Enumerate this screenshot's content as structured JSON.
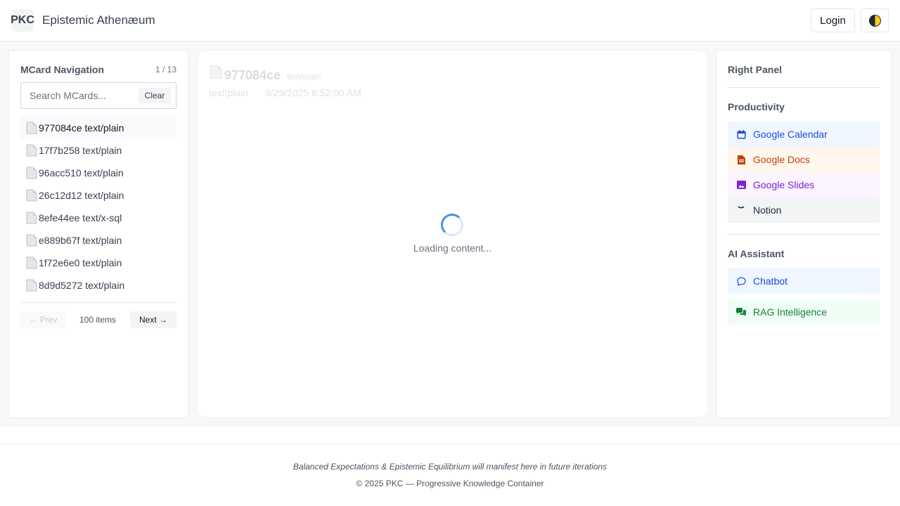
{
  "header": {
    "logo": "PKC",
    "title": "Epistemic Athenæum",
    "login_label": "Login",
    "theme_icon": "half-moon-icon"
  },
  "nav": {
    "title": "MCard Navigation",
    "count": "1 / 13",
    "search_placeholder": "Search MCards...",
    "clear_label": "Clear",
    "items": [
      {
        "hash": "977084ce",
        "type": "text/plain"
      },
      {
        "hash": "17f7b258",
        "type": "text/plain"
      },
      {
        "hash": "96acc510",
        "type": "text/plain"
      },
      {
        "hash": "26c12d12",
        "type": "text/plain"
      },
      {
        "hash": "8efe44ee",
        "type": "text/x-sql"
      },
      {
        "hash": "e889b67f",
        "type": "text/plain"
      },
      {
        "hash": "1f72e6e0",
        "type": "text/plain"
      },
      {
        "hash": "8d9d5272",
        "type": "text/plain"
      }
    ],
    "prev_label": "← Prev",
    "items_count": "100 items",
    "next_label": "Next →"
  },
  "content": {
    "hash": "977084ce",
    "type_badge": "text/plain",
    "type": "text/plain",
    "timestamp": "9/29/2025 6:52:00 AM",
    "loading_text": "Loading content..."
  },
  "right": {
    "title": "Right Panel",
    "productivity_title": "Productivity",
    "productivity": [
      {
        "label": "Google Calendar",
        "icon": "calendar-icon",
        "color": "#1d4ed8",
        "bg": "#eff6ff"
      },
      {
        "label": "Google Docs",
        "icon": "document-icon",
        "color": "#c2410c",
        "bg": "#fff7ed"
      },
      {
        "label": "Google Slides",
        "icon": "image-icon",
        "color": "#7e22ce",
        "bg": "#faf5ff"
      },
      {
        "label": "Notion",
        "icon": "notion-icon",
        "color": "#1f2937",
        "bg": "#f3f4f6"
      }
    ],
    "ai_title": "AI Assistant",
    "ai": [
      {
        "label": "Chatbot",
        "icon": "chat-bubble-icon",
        "color": "#1d4ed8",
        "bg": "#eff6ff"
      },
      {
        "label": "RAG Intelligence",
        "icon": "comments-icon",
        "color": "#15803d",
        "bg": "#f0fdf4"
      }
    ]
  },
  "footer": {
    "tagline": "Balanced Expectations & Epistemic Equilibrium will manifest here in future iterations",
    "copyright": "© 2025 PKC — Progressive Knowledge Container"
  }
}
